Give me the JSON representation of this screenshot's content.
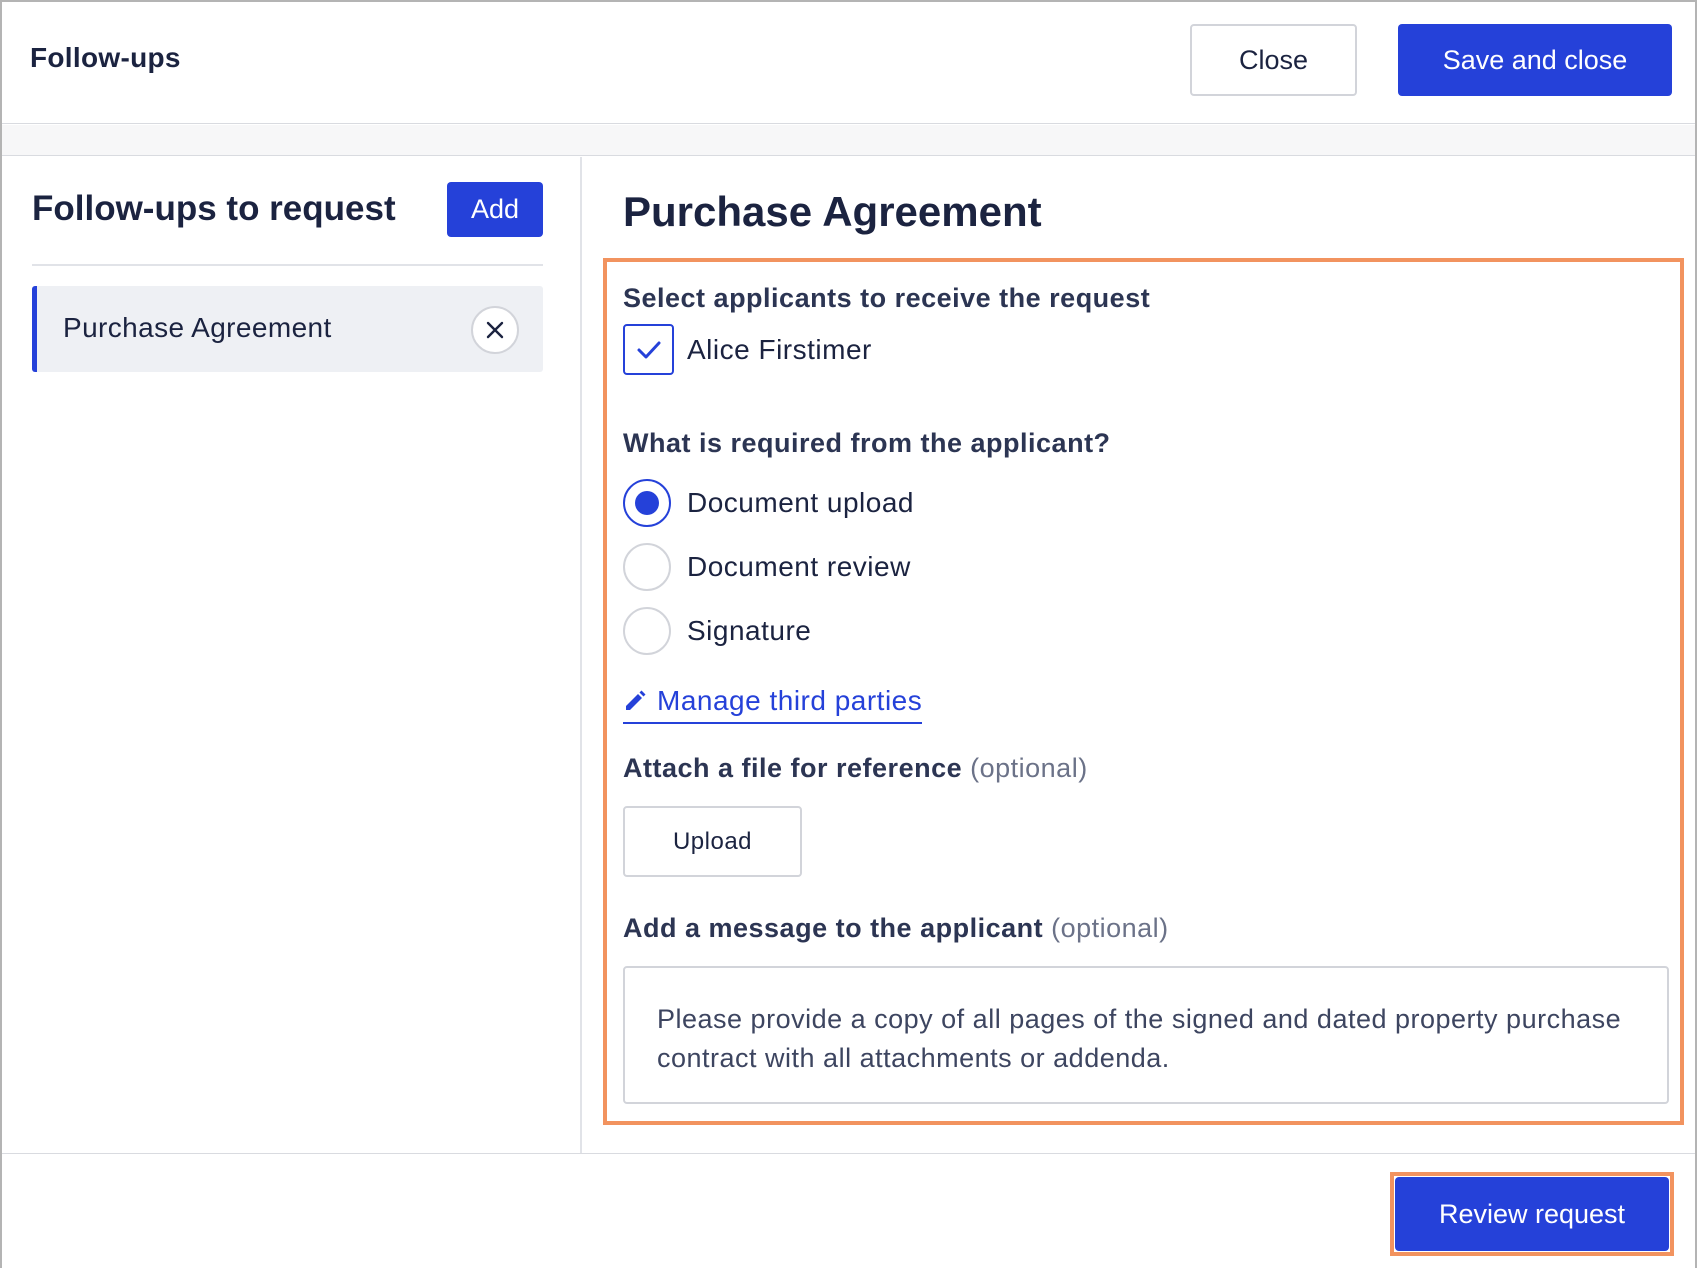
{
  "header": {
    "title": "Follow-ups",
    "close_label": "Close",
    "save_label": "Save and close"
  },
  "sidebar": {
    "title": "Follow-ups to request",
    "add_label": "Add",
    "items": [
      {
        "label": "Purchase Agreement",
        "remove_icon": "close-icon"
      }
    ]
  },
  "main": {
    "title": "Purchase Agreement",
    "applicants": {
      "label": "Select applicants to receive the request",
      "options": [
        {
          "name": "Alice Firstimer",
          "checked": true
        }
      ]
    },
    "requirement": {
      "label": "What is required from the applicant?",
      "options": [
        {
          "label": "Document upload",
          "selected": true
        },
        {
          "label": "Document review",
          "selected": false
        },
        {
          "label": "Signature",
          "selected": false
        }
      ]
    },
    "manage_link": {
      "label": "Manage third parties",
      "icon": "pencil-icon"
    },
    "attach": {
      "label": "Attach a file for reference",
      "optional": "(optional)",
      "upload_label": "Upload"
    },
    "message": {
      "label": "Add a message to the applicant",
      "optional": "(optional)",
      "value": "Please provide a copy of all pages of the signed and dated property purchase contract with all attachments or addenda."
    }
  },
  "footer": {
    "review_label": "Review request"
  },
  "colors": {
    "primary": "#2541d9",
    "highlight": "#f2935f",
    "text": "#1b2340"
  }
}
